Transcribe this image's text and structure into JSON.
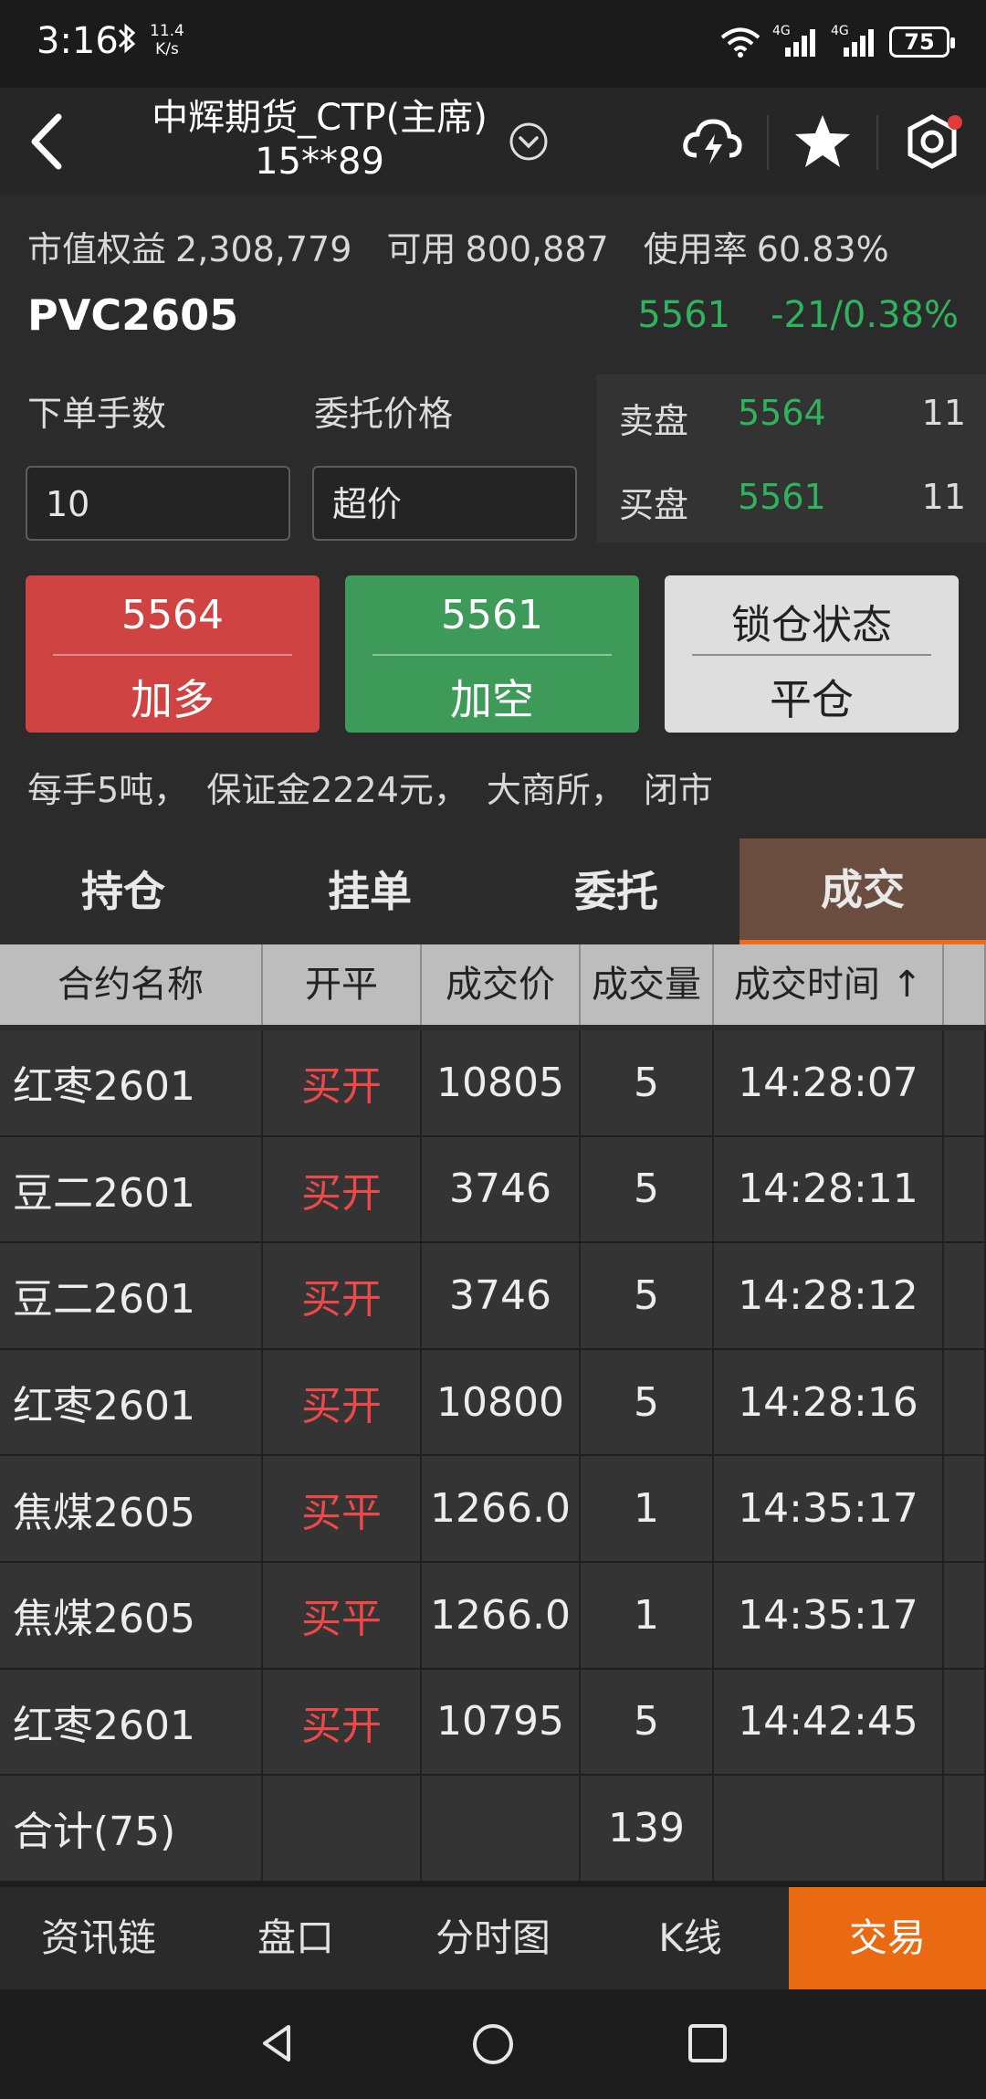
{
  "status_bar": {
    "time": "3:16",
    "net_speed_value": "11.4",
    "net_speed_unit": "K/s",
    "sim1_label": "4G",
    "sim2_label": "4G",
    "battery": "75",
    "icons": [
      "bluetooth-icon",
      "wifi-icon",
      "signal-icon",
      "signal-icon",
      "battery-icon"
    ]
  },
  "header": {
    "title": "中辉期货_CTP(主席)",
    "account": "15**89",
    "icons": [
      "back-arrow-icon",
      "chevron-down-circle-icon",
      "cloud-lightning-icon",
      "star-icon",
      "settings-hexagon-icon"
    ]
  },
  "account_bar": {
    "equity_label": "市值权益",
    "equity_value": "2,308,779",
    "available_label": "可用",
    "available_value": "800,887",
    "usage_label": "使用率",
    "usage_value": "60.83%"
  },
  "instrument": {
    "symbol": "PVC2605",
    "last_price": "5561",
    "change": "-21/0.38%"
  },
  "order_form": {
    "lots_label": "下单手数",
    "lots_value": "10",
    "price_label": "委托价格",
    "price_value": "超价"
  },
  "order_book": {
    "ask_label": "卖盘",
    "ask_price": "5564",
    "ask_volume": "11",
    "bid_label": "买盘",
    "bid_price": "5561",
    "bid_volume": "11"
  },
  "buttons": {
    "long_price": "5564",
    "long_label": "加多",
    "short_price": "5561",
    "short_label": "加空",
    "lock_label": "锁仓状态",
    "close_label": "平仓"
  },
  "contract_info": {
    "lot_size": "每手5吨，",
    "margin": "保证金2224元，",
    "exchange": "大商所，",
    "market_status": "闭市"
  },
  "tabs": [
    "持仓",
    "挂单",
    "委托",
    "成交"
  ],
  "active_tab": "成交",
  "table": {
    "headers": [
      "合约名称",
      "开平",
      "成交价",
      "成交量",
      "成交时间 ↑"
    ],
    "rows": [
      {
        "name": "红枣2601",
        "side": "买开",
        "price": "10805",
        "qty": "5",
        "time": "14:28:07"
      },
      {
        "name": "豆二2601",
        "side": "买开",
        "price": "3746",
        "qty": "5",
        "time": "14:28:11"
      },
      {
        "name": "豆二2601",
        "side": "买开",
        "price": "3746",
        "qty": "5",
        "time": "14:28:12"
      },
      {
        "name": "红枣2601",
        "side": "买开",
        "price": "10800",
        "qty": "5",
        "time": "14:28:16"
      },
      {
        "name": "焦煤2605",
        "side": "买平",
        "price": "1266.0",
        "qty": "1",
        "time": "14:35:17"
      },
      {
        "name": "焦煤2605",
        "side": "买平",
        "price": "1266.0",
        "qty": "1",
        "time": "14:35:17"
      },
      {
        "name": "红枣2601",
        "side": "买开",
        "price": "10795",
        "qty": "5",
        "time": "14:42:45"
      }
    ],
    "total_label": "合计(75)",
    "total_qty": "139"
  },
  "bottom_nav": [
    "资讯链",
    "盘口",
    "分时图",
    "K线",
    "交易"
  ],
  "bottom_nav_active": "交易",
  "colors": {
    "up_red": "#cf4343",
    "down_green": "#3d9a58",
    "price_green": "#2fb35c",
    "accent_orange": "#ea6a12",
    "buy_text_red": "#f04848"
  }
}
